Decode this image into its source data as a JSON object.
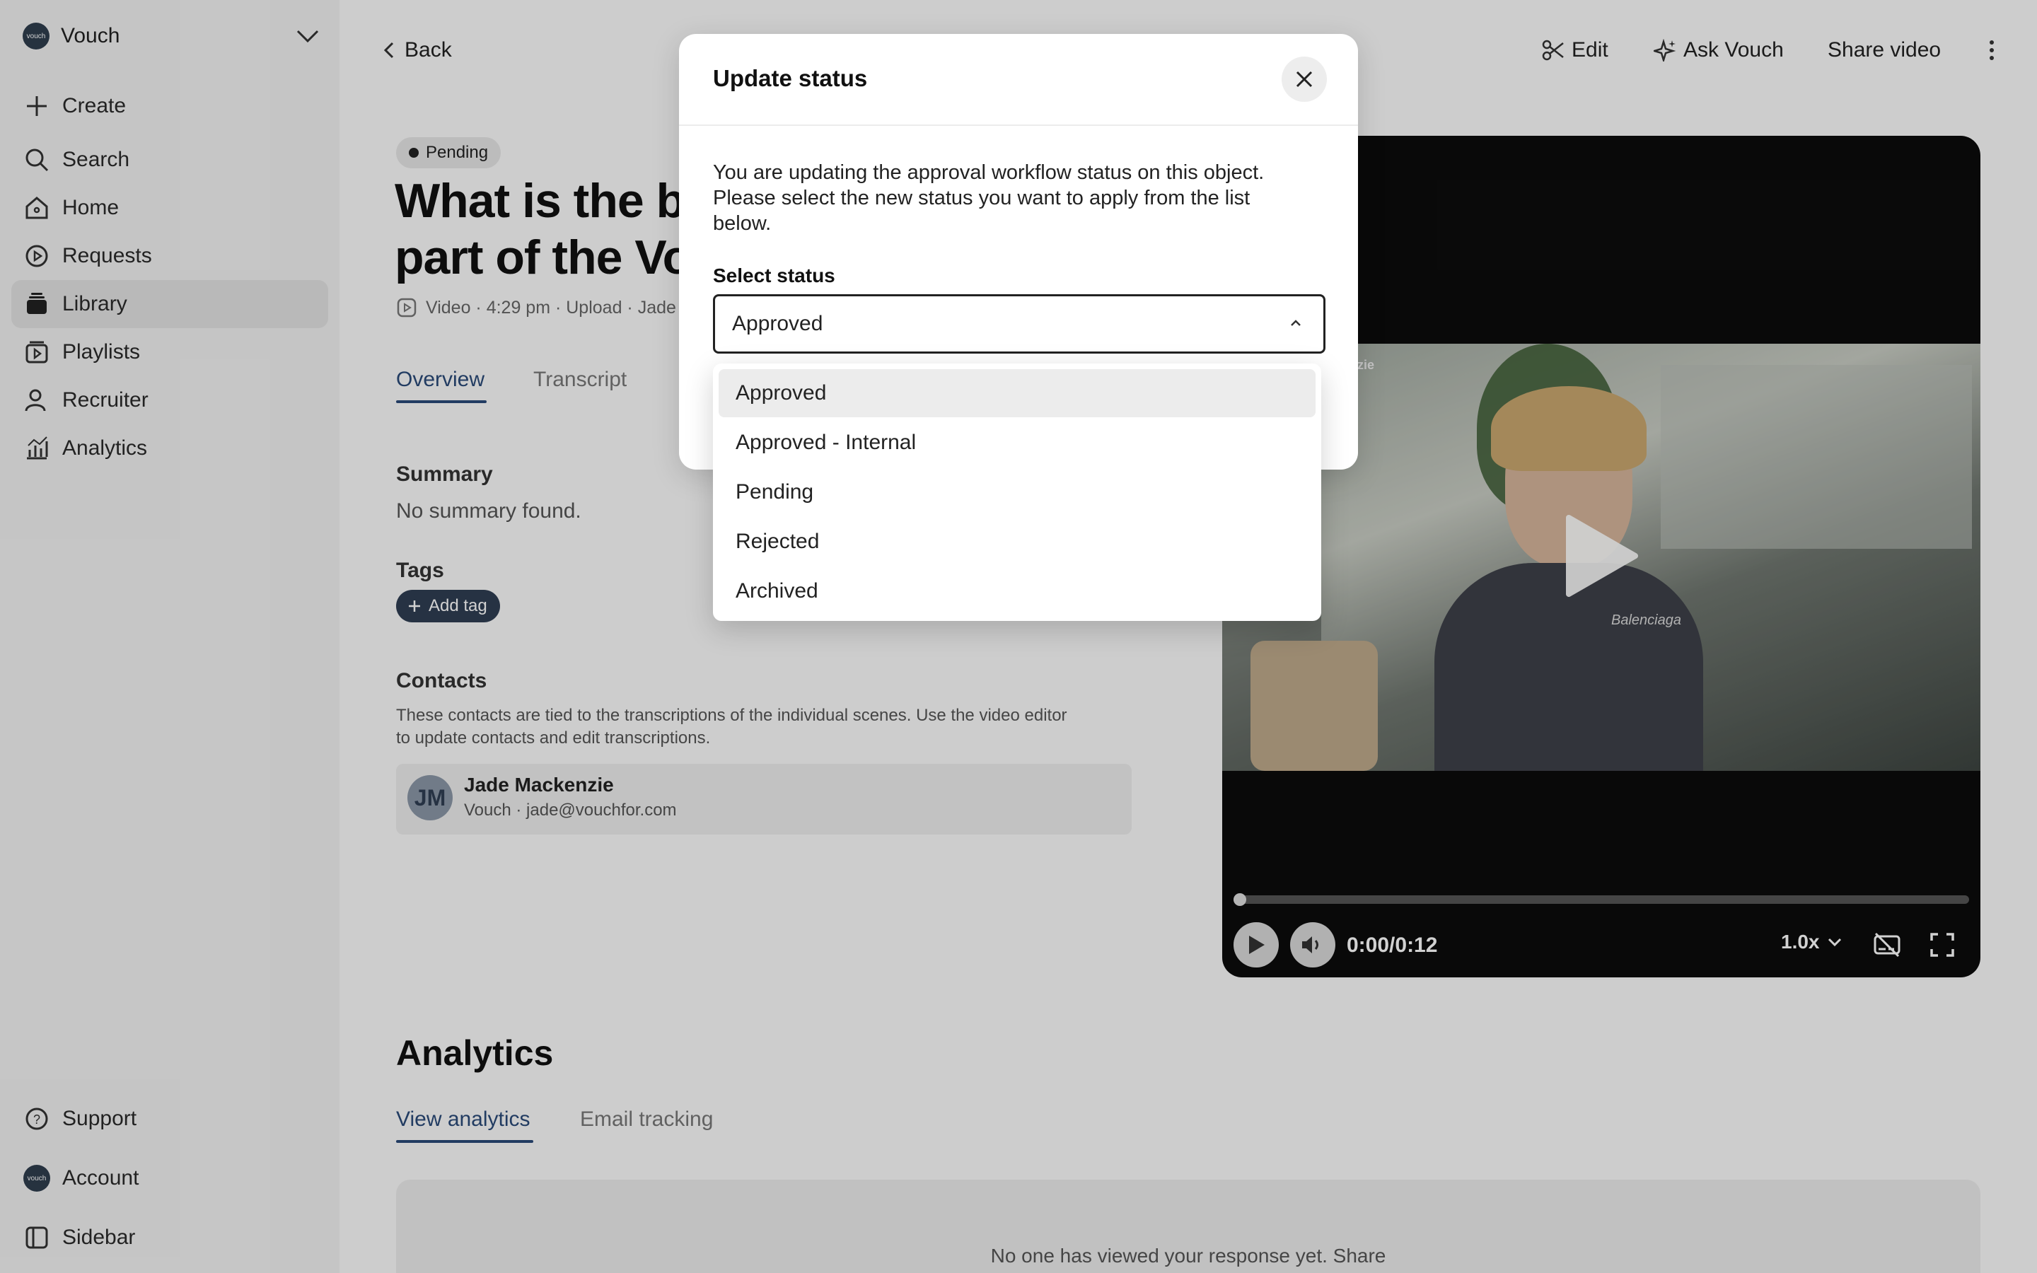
{
  "sidebar": {
    "workspace": "Vouch",
    "logo_text": "vouch",
    "items": [
      {
        "label": "Create",
        "icon": "plus-icon"
      },
      {
        "label": "Search",
        "icon": "search-icon"
      },
      {
        "label": "Home",
        "icon": "home-icon"
      },
      {
        "label": "Requests",
        "icon": "requests-icon"
      },
      {
        "label": "Library",
        "icon": "library-icon",
        "active": true
      },
      {
        "label": "Playlists",
        "icon": "playlists-icon"
      },
      {
        "label": "Recruiter",
        "icon": "recruiter-icon"
      },
      {
        "label": "Analytics",
        "icon": "analytics-icon"
      }
    ],
    "bottom": [
      {
        "label": "Support",
        "icon": "help-icon"
      },
      {
        "label": "Account",
        "icon": "account-icon"
      },
      {
        "label": "Sidebar",
        "icon": "sidebar-icon"
      }
    ]
  },
  "header": {
    "back": "Back",
    "edit": "Edit",
    "ask": "Ask Vouch",
    "share": "Share video"
  },
  "content": {
    "status_badge": "Pending",
    "title_line1": "What is the be",
    "title_line2": "part of the Vou",
    "meta": "Video · 4:29 pm · Upload · Jade",
    "tabs": [
      "Overview",
      "Transcript"
    ],
    "summary_label": "Summary",
    "summary_text": "No summary found.",
    "tags_label": "Tags",
    "add_tag": "Add tag",
    "contacts_label": "Contacts",
    "contacts_desc_1": "These contacts are tied to the transcriptions of the individual scenes. Use the video editor",
    "contacts_desc_2": "to update contacts and edit transcriptions.",
    "contact": {
      "initials": "JM",
      "name": "Jade Mackenzie",
      "detail": "Vouch · jade@vouchfor.com"
    }
  },
  "video": {
    "time": "0:00/0:12",
    "speed": "1.0x",
    "shirt_text": "Balenciaga",
    "caption_text": "nzie"
  },
  "analytics": {
    "heading": "Analytics",
    "tabs": [
      "View analytics",
      "Email tracking"
    ],
    "empty_text": "No one has viewed your response yet. Share"
  },
  "modal": {
    "title": "Update status",
    "desc_1": "You are updating the approval workflow status on this object.",
    "desc_2": "Please select the new status you want to apply from the list",
    "desc_3": "below.",
    "select_label": "Select status",
    "selected": "Approved",
    "options": [
      "Approved",
      "Approved - Internal",
      "Pending",
      "Rejected",
      "Archived"
    ]
  }
}
